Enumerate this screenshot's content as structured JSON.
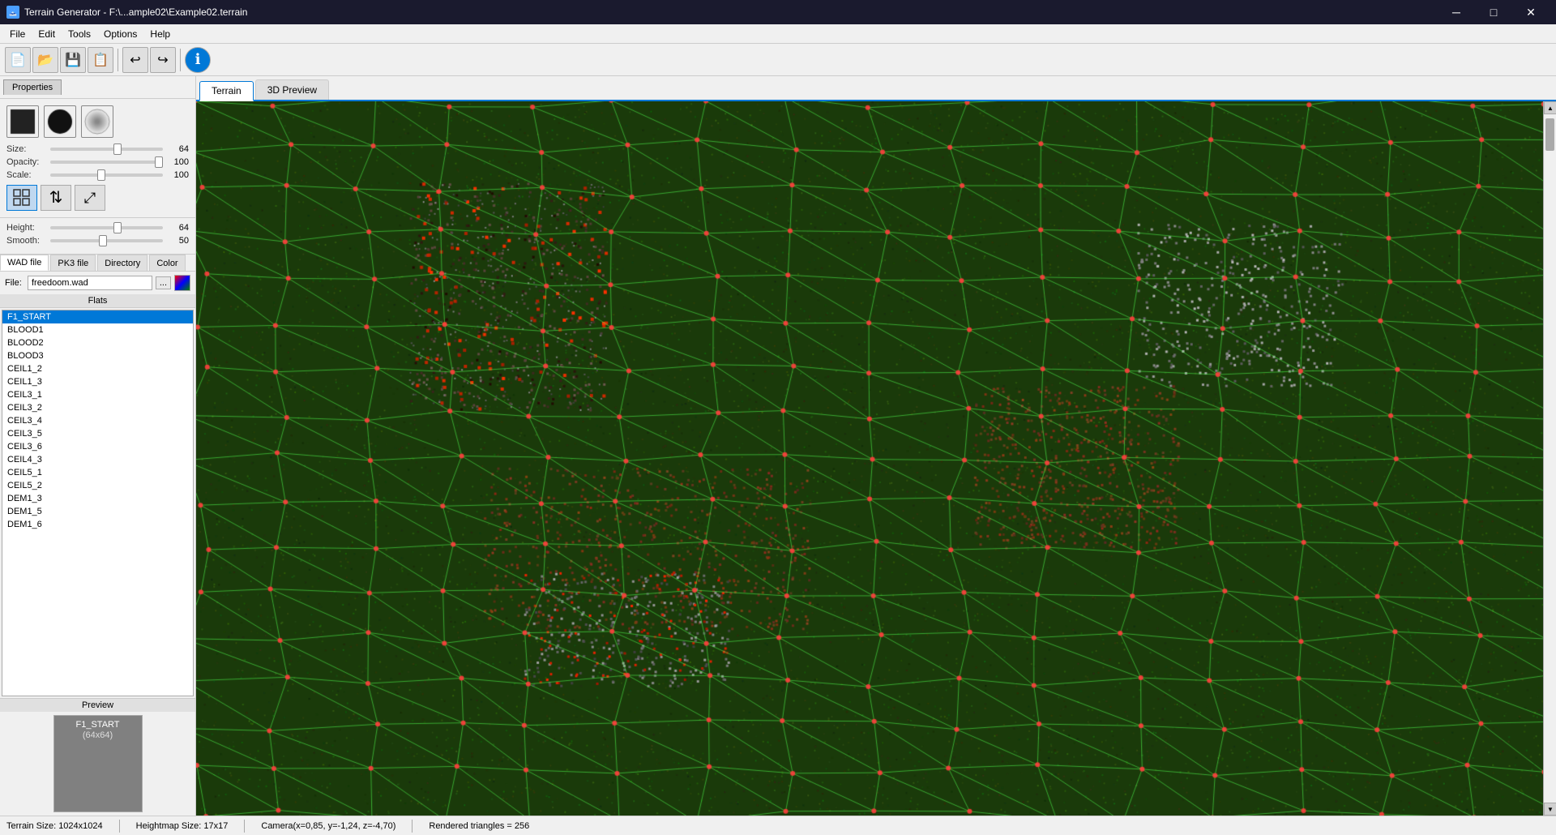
{
  "titlebar": {
    "icon": "🗻",
    "title": "Terrain Generator - F:\\...ample02\\Example02.terrain",
    "minimize": "─",
    "maximize": "□",
    "close": "✕"
  },
  "menubar": {
    "items": [
      "File",
      "Edit",
      "Tools",
      "Options",
      "Help"
    ]
  },
  "toolbar": {
    "buttons": [
      {
        "name": "new",
        "icon": "📄"
      },
      {
        "name": "open",
        "icon": "📂"
      },
      {
        "name": "save",
        "icon": "💾"
      },
      {
        "name": "save-as",
        "icon": "📋"
      },
      {
        "name": "undo",
        "icon": "↩"
      },
      {
        "name": "redo",
        "icon": "↪"
      },
      {
        "name": "info",
        "icon": "ℹ"
      }
    ]
  },
  "properties_tab": {
    "label": "Properties"
  },
  "brush": {
    "size_label": "Size:",
    "size_value": "64",
    "size_pct": 60,
    "opacity_label": "Opacity:",
    "opacity_value": "100",
    "opacity_pct": 100,
    "scale_label": "Scale:",
    "scale_value": "100",
    "scale_pct": 45
  },
  "brush_modes": [
    {
      "name": "grid",
      "icon": "⊞"
    },
    {
      "name": "arrows-ud",
      "icon": "↕"
    },
    {
      "name": "arrows-expand",
      "icon": "⤢"
    }
  ],
  "height_smooth": {
    "height_label": "Height:",
    "height_value": "64",
    "height_pct": 60,
    "smooth_label": "Smooth:",
    "smooth_value": "50",
    "smooth_pct": 47
  },
  "texture_tabs": {
    "items": [
      "WAD file",
      "PK3 file",
      "Directory",
      "Color"
    ],
    "active": 0
  },
  "file_row": {
    "label": "File:",
    "value": "freedoom.wad",
    "dots": "..."
  },
  "flats": {
    "header": "Flats",
    "items": [
      "F1_START",
      "BLOOD1",
      "BLOOD2",
      "BLOOD3",
      "CEIL1_2",
      "CEIL1_3",
      "CEIL3_1",
      "CEIL3_2",
      "CEIL3_4",
      "CEIL3_5",
      "CEIL3_6",
      "CEIL4_3",
      "CEIL5_1",
      "CEIL5_2",
      "DEM1_3",
      "DEM1_5",
      "DEM1_6"
    ],
    "selected": 0
  },
  "preview": {
    "header": "Preview",
    "name": "F1_START",
    "size": "(64x64)"
  },
  "tabs": {
    "items": [
      "Terrain",
      "3D Preview"
    ],
    "active": 0
  },
  "statusbar": {
    "terrain_size": "Terrain Size: 1024x1024",
    "heightmap_size": "Heightmap Size: 17x17",
    "camera": "Camera(x=0,85, y=-1,24, z=-4,70)",
    "triangles": "Rendered triangles = 256"
  }
}
